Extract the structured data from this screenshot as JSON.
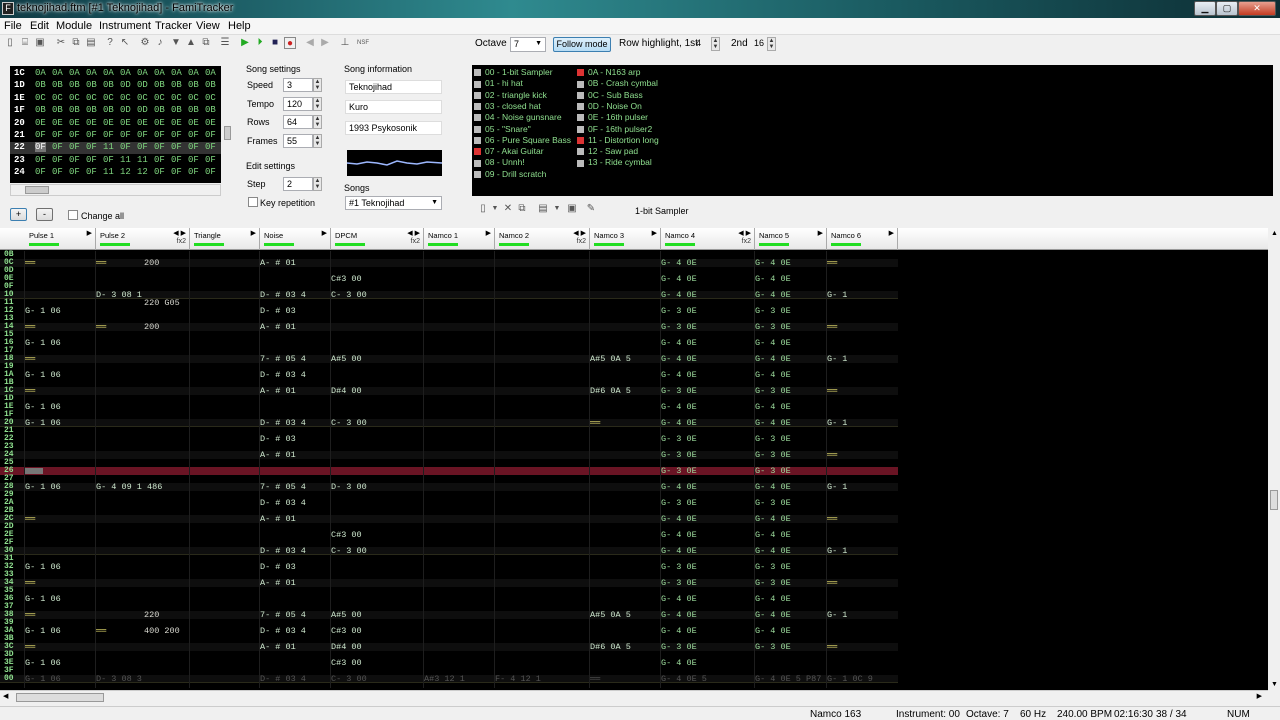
{
  "window": {
    "title": "teknojihad.ftm [#1 Teknojihad] - FamiTracker",
    "app_icon": "F"
  },
  "menu": [
    "File",
    "Edit",
    "Module",
    "Instrument",
    "Tracker",
    "View",
    "Help"
  ],
  "toolbar": {
    "octave_label": "Octave",
    "octave_value": "7",
    "follow_mode_label": "Follow mode",
    "row_highlight_label": "Row highlight, 1st",
    "row_highlight_1st": "4",
    "second_label": "2nd",
    "row_highlight_2nd": "16"
  },
  "song_settings": {
    "title": "Song settings",
    "speed_label": "Speed",
    "speed": "3",
    "tempo_label": "Tempo",
    "tempo": "120",
    "rows_label": "Rows",
    "rows": "64",
    "frames_label": "Frames",
    "frames": "55"
  },
  "edit_settings": {
    "title": "Edit settings",
    "step_label": "Step",
    "step": "2",
    "key_repetition_label": "Key repetition"
  },
  "song_info": {
    "title": "Song information",
    "name": "Teknojihad",
    "artist": "Kuro",
    "copyright": "1993 Psykosonik",
    "songs_label": "Songs",
    "selected_song": "#1 Teknojihad"
  },
  "frame_controls": {
    "add": "+",
    "remove": "-",
    "change_all_label": "Change all"
  },
  "frames": [
    {
      "num": "1C",
      "cells": [
        "0A",
        "0A",
        "0A",
        "0A",
        "0A",
        "0A",
        "0A",
        "0A",
        "0A",
        "0A",
        "0A"
      ]
    },
    {
      "num": "1D",
      "cells": [
        "0B",
        "0B",
        "0B",
        "0B",
        "0B",
        "0D",
        "0D",
        "0B",
        "0B",
        "0B",
        "0B"
      ]
    },
    {
      "num": "1E",
      "cells": [
        "0C",
        "0C",
        "0C",
        "0C",
        "0C",
        "0C",
        "0C",
        "0C",
        "0C",
        "0C",
        "0C"
      ]
    },
    {
      "num": "1F",
      "cells": [
        "0B",
        "0B",
        "0B",
        "0B",
        "0B",
        "0D",
        "0D",
        "0B",
        "0B",
        "0B",
        "0B"
      ]
    },
    {
      "num": "20",
      "cells": [
        "0E",
        "0E",
        "0E",
        "0E",
        "0E",
        "0E",
        "0E",
        "0E",
        "0E",
        "0E",
        "0E"
      ]
    },
    {
      "num": "21",
      "cells": [
        "0F",
        "0F",
        "0F",
        "0F",
        "0F",
        "0F",
        "0F",
        "0F",
        "0F",
        "0F",
        "0F"
      ]
    },
    {
      "num": "22",
      "cells": [
        "0F",
        "0F",
        "0F",
        "0F",
        "11",
        "0F",
        "0F",
        "0F",
        "0F",
        "0F",
        "0F"
      ]
    },
    {
      "num": "23",
      "cells": [
        "0F",
        "0F",
        "0F",
        "0F",
        "0F",
        "11",
        "11",
        "0F",
        "0F",
        "0F",
        "0F"
      ]
    },
    {
      "num": "24",
      "cells": [
        "0F",
        "0F",
        "0F",
        "0F",
        "11",
        "12",
        "12",
        "0F",
        "0F",
        "0F",
        "0F"
      ]
    }
  ],
  "instruments": [
    {
      "label": "00 - 1-bit Sampler",
      "color": "#8fe08f"
    },
    {
      "label": "01 - hi hat",
      "color": "#8fe08f"
    },
    {
      "label": "02 - triangle kick",
      "color": "#8fe08f"
    },
    {
      "label": "03 - closed hat",
      "color": "#8fe08f"
    },
    {
      "label": "04 - Noise gunsnare",
      "color": "#8fe08f"
    },
    {
      "label": "05 - \"Snare\"",
      "color": "#8fe08f"
    },
    {
      "label": "06 - Pure Square Bass",
      "color": "#8fe08f"
    },
    {
      "label": "07 - Akai Guitar",
      "color": "#8fe08f"
    },
    {
      "label": "08 - Unnh!",
      "color": "#8fe08f"
    },
    {
      "label": "09 - Drill scratch",
      "color": "#8fe08f"
    },
    {
      "label": "0A - N163 arp",
      "color": "#8fe08f"
    },
    {
      "label": "0B - Crash cymbal",
      "color": "#8fe08f"
    },
    {
      "label": "0C - Sub Bass",
      "color": "#8fe08f"
    },
    {
      "label": "0D - Noise On",
      "color": "#8fe08f"
    },
    {
      "label": "0E - 16th pulser",
      "color": "#8fe08f"
    },
    {
      "label": "0F - 16th pulser2",
      "color": "#8fe08f"
    },
    {
      "label": "11 - Distortion long",
      "color": "#8fe08f"
    },
    {
      "label": "12 - Saw pad",
      "color": "#8fe08f"
    },
    {
      "label": "13 - Ride cymbal",
      "color": "#8fe08f"
    }
  ],
  "instrument_name": "1-bit Sampler",
  "channels": [
    {
      "name": "Pulse 1"
    },
    {
      "name": "Pulse 2",
      "fx": "fx2"
    },
    {
      "name": "Triangle"
    },
    {
      "name": "Noise"
    },
    {
      "name": "DPCM",
      "fx": "fx2"
    },
    {
      "name": "Namco 1"
    },
    {
      "name": "Namco 2",
      "fx": "fx2"
    },
    {
      "name": "Namco 3"
    },
    {
      "name": "Namco 4",
      "fx": "fx2"
    },
    {
      "name": "Namco 5"
    },
    {
      "name": "Namco 6"
    }
  ],
  "row_numbers": [
    "0B",
    "0C",
    "0D",
    "0E",
    "0F",
    "10",
    "11",
    "12",
    "13",
    "14",
    "15",
    "16",
    "17",
    "18",
    "19",
    "1A",
    "1B",
    "1C",
    "1D",
    "1E",
    "1F",
    "20",
    "21",
    "22",
    "23",
    "24",
    "25",
    "26",
    "27",
    "28",
    "29",
    "2A",
    "2B",
    "2C",
    "2D",
    "2E",
    "2F",
    "30",
    "31",
    "32",
    "33",
    "34",
    "35",
    "36",
    "37",
    "38",
    "39",
    "3A",
    "3B",
    "3C",
    "3D",
    "3E",
    "3F",
    "00"
  ],
  "pattern_cells": [
    {
      "r": 1,
      "c": 0,
      "t": "══"
    },
    {
      "r": 1,
      "c": 1,
      "t": "══"
    },
    {
      "r": 1,
      "c": 1,
      "x": 1,
      "t": "200"
    },
    {
      "r": 1,
      "c": 3,
      "t": "A- # 01"
    },
    {
      "r": 1,
      "c": 8,
      "t": "G- 4 0E"
    },
    {
      "r": 1,
      "c": 9,
      "t": "G- 4 0E"
    },
    {
      "r": 1,
      "c": 10,
      "t": "══"
    },
    {
      "r": 3,
      "c": 4,
      "t": "C#3 00"
    },
    {
      "r": 3,
      "c": 8,
      "t": "G- 4 0E"
    },
    {
      "r": 3,
      "c": 9,
      "t": "G- 4 0E"
    },
    {
      "r": 5,
      "c": 1,
      "t": "D- 3 08 1"
    },
    {
      "r": 5,
      "c": 3,
      "t": "D- # 03 4"
    },
    {
      "r": 5,
      "c": 4,
      "t": "C- 3 00"
    },
    {
      "r": 5,
      "c": 8,
      "t": "G- 4 0E"
    },
    {
      "r": 5,
      "c": 9,
      "t": "G- 4 0E"
    },
    {
      "r": 5,
      "c": 10,
      "t": "G- 1"
    },
    {
      "r": 6,
      "c": 1,
      "x": 1,
      "t": "220 G05"
    },
    {
      "r": 7,
      "c": 0,
      "t": "G- 1 06"
    },
    {
      "r": 7,
      "c": 3,
      "t": "D- # 03"
    },
    {
      "r": 7,
      "c": 8,
      "t": "G- 3 0E"
    },
    {
      "r": 7,
      "c": 9,
      "t": "G- 3 0E"
    },
    {
      "r": 9,
      "c": 0,
      "t": "══"
    },
    {
      "r": 9,
      "c": 1,
      "t": "══"
    },
    {
      "r": 9,
      "c": 1,
      "x": 1,
      "t": "200"
    },
    {
      "r": 9,
      "c": 3,
      "t": "A- # 01"
    },
    {
      "r": 9,
      "c": 8,
      "t": "G- 3 0E"
    },
    {
      "r": 9,
      "c": 9,
      "t": "G- 3 0E"
    },
    {
      "r": 9,
      "c": 10,
      "t": "══"
    },
    {
      "r": 11,
      "c": 0,
      "t": "G- 1 06"
    },
    {
      "r": 11,
      "c": 8,
      "t": "G- 4 0E"
    },
    {
      "r": 11,
      "c": 9,
      "t": "G- 4 0E"
    },
    {
      "r": 13,
      "c": 0,
      "t": "══"
    },
    {
      "r": 13,
      "c": 3,
      "t": "7- # 05 4"
    },
    {
      "r": 13,
      "c": 4,
      "t": "A#5 00"
    },
    {
      "r": 13,
      "c": 7,
      "t": "A#5 0A 5"
    },
    {
      "r": 13,
      "c": 8,
      "t": "G- 4 0E"
    },
    {
      "r": 13,
      "c": 9,
      "t": "G- 4 0E"
    },
    {
      "r": 13,
      "c": 10,
      "t": "G- 1"
    },
    {
      "r": 15,
      "c": 0,
      "t": "G- 1 06"
    },
    {
      "r": 15,
      "c": 3,
      "t": "D- # 03 4"
    },
    {
      "r": 15,
      "c": 8,
      "t": "G- 4 0E"
    },
    {
      "r": 15,
      "c": 9,
      "t": "G- 4 0E"
    },
    {
      "r": 17,
      "c": 0,
      "t": "══"
    },
    {
      "r": 17,
      "c": 3,
      "t": "A- # 01"
    },
    {
      "r": 17,
      "c": 4,
      "t": "D#4 00"
    },
    {
      "r": 17,
      "c": 7,
      "t": "D#6 0A 5"
    },
    {
      "r": 17,
      "c": 8,
      "t": "G- 3 0E"
    },
    {
      "r": 17,
      "c": 9,
      "t": "G- 3 0E"
    },
    {
      "r": 17,
      "c": 10,
      "t": "══"
    },
    {
      "r": 19,
      "c": 0,
      "t": "G- 1 06"
    },
    {
      "r": 19,
      "c": 8,
      "t": "G- 4 0E"
    },
    {
      "r": 19,
      "c": 9,
      "t": "G- 4 0E"
    },
    {
      "r": 21,
      "c": 0,
      "t": "G- 1 06"
    },
    {
      "r": 21,
      "c": 3,
      "t": "D- # 03 4"
    },
    {
      "r": 21,
      "c": 4,
      "t": "C- 3 00"
    },
    {
      "r": 21,
      "c": 7,
      "t": "══"
    },
    {
      "r": 21,
      "c": 8,
      "t": "G- 4 0E"
    },
    {
      "r": 21,
      "c": 9,
      "t": "G- 4 0E"
    },
    {
      "r": 21,
      "c": 10,
      "t": "G- 1"
    },
    {
      "r": 23,
      "c": 3,
      "t": "D- # 03"
    },
    {
      "r": 23,
      "c": 8,
      "t": "G- 3 0E"
    },
    {
      "r": 23,
      "c": 9,
      "t": "G- 3 0E"
    },
    {
      "r": 25,
      "c": 3,
      "t": "A- # 01"
    },
    {
      "r": 25,
      "c": 8,
      "t": "G- 3 0E"
    },
    {
      "r": 25,
      "c": 9,
      "t": "G- 3 0E"
    },
    {
      "r": 25,
      "c": 10,
      "t": "══"
    },
    {
      "r": 27,
      "c": 8,
      "t": "G- 3 0E"
    },
    {
      "r": 27,
      "c": 9,
      "t": "G- 3 0E"
    },
    {
      "r": 29,
      "c": 0,
      "t": "G- 1 06"
    },
    {
      "r": 29,
      "c": 1,
      "t": "G- 4 09 1 486"
    },
    {
      "r": 29,
      "c": 3,
      "t": "7- # 05 4"
    },
    {
      "r": 29,
      "c": 4,
      "t": "D- 3 00"
    },
    {
      "r": 29,
      "c": 8,
      "t": "G- 4 0E"
    },
    {
      "r": 29,
      "c": 9,
      "t": "G- 4 0E"
    },
    {
      "r": 29,
      "c": 10,
      "t": "G- 1"
    },
    {
      "r": 31,
      "c": 3,
      "t": "D- # 03 4"
    },
    {
      "r": 31,
      "c": 8,
      "t": "G- 3 0E"
    },
    {
      "r": 31,
      "c": 9,
      "t": "G- 3 0E"
    },
    {
      "r": 33,
      "c": 0,
      "t": "══"
    },
    {
      "r": 33,
      "c": 3,
      "t": "A- # 01"
    },
    {
      "r": 33,
      "c": 8,
      "t": "G- 4 0E"
    },
    {
      "r": 33,
      "c": 9,
      "t": "G- 4 0E"
    },
    {
      "r": 33,
      "c": 10,
      "t": "══"
    },
    {
      "r": 35,
      "c": 4,
      "t": "C#3 00"
    },
    {
      "r": 35,
      "c": 8,
      "t": "G- 4 0E"
    },
    {
      "r": 35,
      "c": 9,
      "t": "G- 4 0E"
    },
    {
      "r": 37,
      "c": 3,
      "t": "D- # 03 4"
    },
    {
      "r": 37,
      "c": 4,
      "t": "C- 3 00"
    },
    {
      "r": 37,
      "c": 8,
      "t": "G- 4 0E"
    },
    {
      "r": 37,
      "c": 9,
      "t": "G- 4 0E"
    },
    {
      "r": 37,
      "c": 10,
      "t": "G- 1"
    },
    {
      "r": 39,
      "c": 0,
      "t": "G- 1 06"
    },
    {
      "r": 39,
      "c": 3,
      "t": "D- # 03"
    },
    {
      "r": 39,
      "c": 8,
      "t": "G- 3 0E"
    },
    {
      "r": 39,
      "c": 9,
      "t": "G- 3 0E"
    },
    {
      "r": 41,
      "c": 0,
      "t": "══"
    },
    {
      "r": 41,
      "c": 3,
      "t": "A- # 01"
    },
    {
      "r": 41,
      "c": 8,
      "t": "G- 3 0E"
    },
    {
      "r": 41,
      "c": 9,
      "t": "G- 3 0E"
    },
    {
      "r": 41,
      "c": 10,
      "t": "══"
    },
    {
      "r": 43,
      "c": 0,
      "t": "G- 1 06"
    },
    {
      "r": 43,
      "c": 8,
      "t": "G- 4 0E"
    },
    {
      "r": 43,
      "c": 9,
      "t": "G- 4 0E"
    },
    {
      "r": 45,
      "c": 0,
      "t": "══"
    },
    {
      "r": 45,
      "c": 1,
      "x": 1,
      "t": "220"
    },
    {
      "r": 45,
      "c": 3,
      "t": "7- # 05 4"
    },
    {
      "r": 45,
      "c": 4,
      "t": "A#5 00"
    },
    {
      "r": 45,
      "c": 7,
      "t": "A#5 0A 5"
    },
    {
      "r": 45,
      "c": 8,
      "t": "G- 4 0E"
    },
    {
      "r": 45,
      "c": 9,
      "t": "G- 4 0E"
    },
    {
      "r": 45,
      "c": 10,
      "t": "G- 1"
    },
    {
      "r": 47,
      "c": 0,
      "t": "G- 1 06"
    },
    {
      "r": 47,
      "c": 1,
      "t": "══"
    },
    {
      "r": 47,
      "c": 1,
      "x": 1,
      "t": "400 200"
    },
    {
      "r": 47,
      "c": 3,
      "t": "D- # 03 4"
    },
    {
      "r": 47,
      "c": 4,
      "t": "C#3 00"
    },
    {
      "r": 47,
      "c": 8,
      "t": "G- 4 0E"
    },
    {
      "r": 47,
      "c": 9,
      "t": "G- 4 0E"
    },
    {
      "r": 49,
      "c": 0,
      "t": "══"
    },
    {
      "r": 49,
      "c": 3,
      "t": "A- # 01"
    },
    {
      "r": 49,
      "c": 4,
      "t": "D#4 00"
    },
    {
      "r": 49,
      "c": 7,
      "t": "D#6 0A 5"
    },
    {
      "r": 49,
      "c": 8,
      "t": "G- 3 0E"
    },
    {
      "r": 49,
      "c": 9,
      "t": "G- 3 0E"
    },
    {
      "r": 49,
      "c": 10,
      "t": "══"
    },
    {
      "r": 51,
      "c": 0,
      "t": "G- 1 06"
    },
    {
      "r": 51,
      "c": 4,
      "t": "C#3 00"
    },
    {
      "r": 51,
      "c": 8,
      "t": "G- 4 0E"
    },
    {
      "r": 53,
      "c": 0,
      "t": "G- 1 06",
      "dim": 1
    },
    {
      "r": 53,
      "c": 1,
      "t": "D- 3 08 3",
      "dim": 1
    },
    {
      "r": 53,
      "c": 3,
      "t": "D- # 03 4",
      "dim": 1
    },
    {
      "r": 53,
      "c": 4,
      "t": "C- 3 00",
      "dim": 1
    },
    {
      "r": 53,
      "c": 5,
      "t": "A#3 12 1",
      "dim": 1
    },
    {
      "r": 53,
      "c": 6,
      "t": "F- 4 12 1",
      "dim": 1
    },
    {
      "r": 53,
      "c": 7,
      "t": "══",
      "dim": 1
    },
    {
      "r": 53,
      "c": 8,
      "t": "G- 4 0E 5",
      "dim": 1
    },
    {
      "r": 53,
      "c": 9,
      "t": "G- 4 0E 5 P87",
      "dim": 1
    },
    {
      "r": 53,
      "c": 10,
      "t": "G- 1 0C 9",
      "dim": 1
    }
  ],
  "status": {
    "chip": "Namco 163",
    "instrument": "Instrument: 00",
    "octave": "Octave: 7",
    "rate": "60 Hz",
    "bpm": "240.00 BPM",
    "time": "02:16:30",
    "position": "38 / 34",
    "numlock": "NUM"
  }
}
